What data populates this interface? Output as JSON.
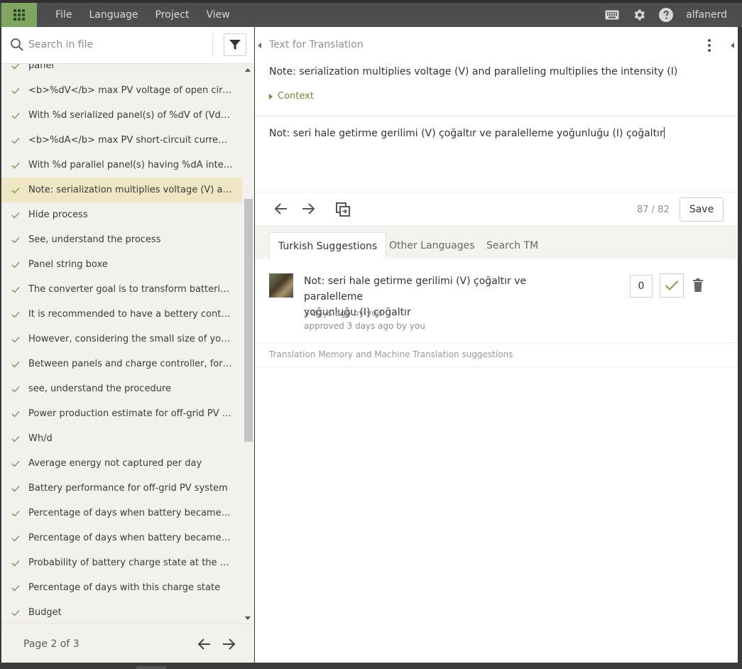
{
  "menu": {
    "file": "File",
    "language": "Language",
    "project": "Project",
    "view": "View"
  },
  "user": {
    "name": "alfanerd"
  },
  "icons": {
    "apps": "apps-grid-icon",
    "keyboard": "keyboard-icon",
    "settings": "gear-icon",
    "help": "help-icon",
    "search": "search-icon",
    "filter": "filter-icon",
    "check": "check-icon",
    "prev": "arrow-left-icon",
    "next": "arrow-right-icon",
    "copy": "copy-source-icon",
    "delete": "trash-icon"
  },
  "colors": {
    "topbar": "#4d4d4d",
    "accent": "#7ea65e",
    "check": "#7ea65e",
    "selected_row": "#efe6c3",
    "context": "#6b8a36"
  },
  "search": {
    "placeholder": "Search in file"
  },
  "units": [
    {
      "text": "panel"
    },
    {
      "text": "<b>%dV</b> max PV voltage of open circuit :"
    },
    {
      "text": "With %d serialized panel(s) of %dV of (Vdoc) voltage"
    },
    {
      "text": "<b>%dA</b> max PV short-circuit current :"
    },
    {
      "text": "With %d parallel panel(s) having %dA intensity each"
    },
    {
      "text": "Note: serialization multiplies voltage (V) and paralleling multiplies the intensity (I)"
    },
    {
      "text": "Hide process"
    },
    {
      "text": "See, understand the process"
    },
    {
      "text": "Panel string boxe"
    },
    {
      "text": "The converter goal is to transform batteries DC voltage"
    },
    {
      "text": "It is recommended to have a bettery controller"
    },
    {
      "text": "However, considering the small size of your system"
    },
    {
      "text": "Between panels and charge controller, for a distance"
    },
    {
      "text": "see, understand the procedure"
    },
    {
      "text": "Power production estimate for off-grid PV system"
    },
    {
      "text": "Wh/d"
    },
    {
      "text": "Average energy not captured per day"
    },
    {
      "text": "Battery performance for off-grid PV system"
    },
    {
      "text": "Percentage of days when battery became full"
    },
    {
      "text": "Percentage of days when battery became empty"
    },
    {
      "text": "Probability of battery charge state at the end of the day"
    },
    {
      "text": "Percentage of days with this charge state"
    },
    {
      "text": "Budget"
    }
  ],
  "selected_index": 5,
  "pager": {
    "label": "Page 2 of 3"
  },
  "source": {
    "label": "Text for Translation",
    "text": "Note: serialization multiplies voltage (V) and paralleling multiplies the intensity (I)",
    "context_label": "Context"
  },
  "translation": {
    "value": "Not: seri hale getirme gerilimi (V) çoğaltır ve paralelleme yoğunluğu (I) çoğaltır"
  },
  "editor_toolbar": {
    "counter": "87 / 82",
    "save_label": "Save"
  },
  "tabs": [
    {
      "label": "Turkish Suggestions"
    },
    {
      "label": "Other Languages"
    },
    {
      "label": "Search TM"
    }
  ],
  "suggestion": {
    "line1": "Not: seri hale getirme gerilimi (V) çoğaltır ve paralelleme",
    "line2": "yoğunluğu (I) çoğaltır",
    "meta1": "3 days ago by you",
    "meta2": "approved 3 days ago by you",
    "votes": "0"
  },
  "tm_label": "Translation Memory and Machine Translation suggestions"
}
